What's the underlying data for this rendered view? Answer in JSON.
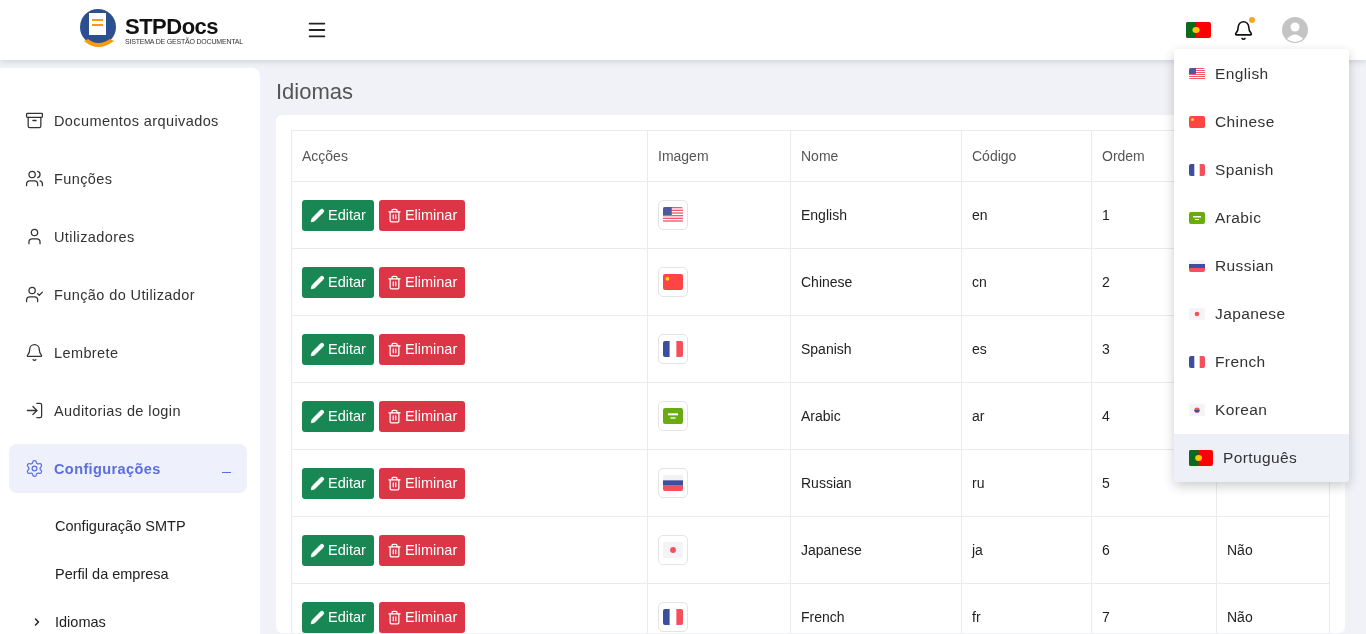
{
  "brand": {
    "name": "STPDocs",
    "tagline": "SISTEMA DE GESTÃO DOCUMENTAL"
  },
  "topbar": {
    "flag": {
      "kind": "pt"
    },
    "notification_dot": true
  },
  "sidebar": {
    "items": [
      {
        "label": "Documentos arquivados",
        "kind": "archive",
        "selected": false
      },
      {
        "label": "Funções",
        "kind": "users",
        "selected": false
      },
      {
        "label": "Utilizadores",
        "kind": "user",
        "selected": false
      },
      {
        "label": "Função do Utilizador",
        "kind": "usercheck",
        "selected": false
      },
      {
        "label": "Lembrete",
        "kind": "bell",
        "selected": false
      },
      {
        "label": "Auditorias de login",
        "kind": "login",
        "selected": false
      },
      {
        "label": "Configurações",
        "kind": "gear",
        "selected": true,
        "expanded": true,
        "children": [
          {
            "label": "Configuração SMTP",
            "selected": false
          },
          {
            "label": "Perfil da empresa",
            "selected": false
          },
          {
            "label": "Idiomas",
            "selected": true
          }
        ]
      }
    ]
  },
  "page": {
    "title": "Idiomas"
  },
  "table": {
    "columns": [
      "Acções",
      "Imagem",
      "Nome",
      "Código",
      "Ordem"
    ],
    "rows": [
      {
        "edit": "Editar",
        "delete": "Eliminar",
        "kind": "us",
        "name": "English",
        "code": "en",
        "order": "1"
      },
      {
        "edit": "Editar",
        "delete": "Eliminar",
        "kind": "cn",
        "name": "Chinese",
        "code": "cn",
        "order": "2"
      },
      {
        "edit": "Editar",
        "delete": "Eliminar",
        "kind": "fr",
        "name": "Spanish",
        "code": "es",
        "order": "3"
      },
      {
        "edit": "Editar",
        "delete": "Eliminar",
        "kind": "sa",
        "name": "Arabic",
        "code": "ar",
        "order": "4"
      },
      {
        "edit": "Editar",
        "delete": "Eliminar",
        "kind": "ru",
        "name": "Russian",
        "code": "ru",
        "order": "5"
      },
      {
        "edit": "Editar",
        "delete": "Eliminar",
        "kind": "jp",
        "name": "Japanese",
        "code": "ja",
        "order": "6",
        "column_6": "Não"
      },
      {
        "edit": "Editar",
        "delete": "Eliminar",
        "kind": "fr",
        "name": "French",
        "code": "fr",
        "order": "7",
        "column_6": "Não"
      }
    ]
  },
  "language_menu": {
    "items": [
      {
        "label": "English",
        "kind": "us",
        "selected": false
      },
      {
        "label": "Chinese",
        "kind": "cn",
        "selected": false
      },
      {
        "label": "Spanish",
        "kind": "fr",
        "selected": false
      },
      {
        "label": "Arabic",
        "kind": "sa",
        "selected": false
      },
      {
        "label": "Russian",
        "kind": "ru",
        "selected": false
      },
      {
        "label": "Japanese",
        "kind": "jp",
        "selected": false
      },
      {
        "label": "French",
        "kind": "fr",
        "selected": false
      },
      {
        "label": "Korean",
        "kind": "kr",
        "selected": false
      },
      {
        "label": "Português",
        "kind": "pt",
        "selected": true
      }
    ]
  }
}
